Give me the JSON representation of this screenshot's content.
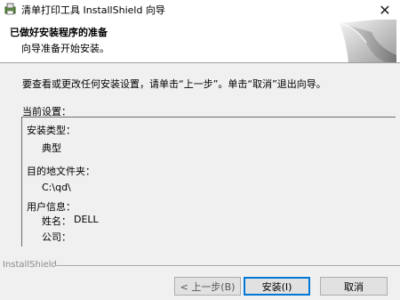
{
  "window": {
    "title": "清单打印工具 InstallShield 向导",
    "icon": "installer-icon",
    "close_glyph": "✕"
  },
  "banner": {
    "title": "已做好安装程序的准备",
    "subtitle": "向导准备开始安装。",
    "graphic": "page-curl-graphic"
  },
  "instruction": "要查看或更改任何安装设置，请单击“上一步”。单击“取消”退出向导。",
  "settings": {
    "heading": "当前设置：",
    "setup_type_label": "安装类型：",
    "setup_type_value": "典型",
    "destination_label": "目的地文件夹：",
    "destination_value": "C:\\qd\\",
    "user_info_label": "用户信息：",
    "name_label": "姓名：",
    "name_value": "DELL",
    "company_label": "公司："
  },
  "footer": {
    "brand": "InstallShield"
  },
  "buttons": {
    "back": "< 上一步(B)",
    "install": "安装(I)",
    "cancel": "取消"
  }
}
